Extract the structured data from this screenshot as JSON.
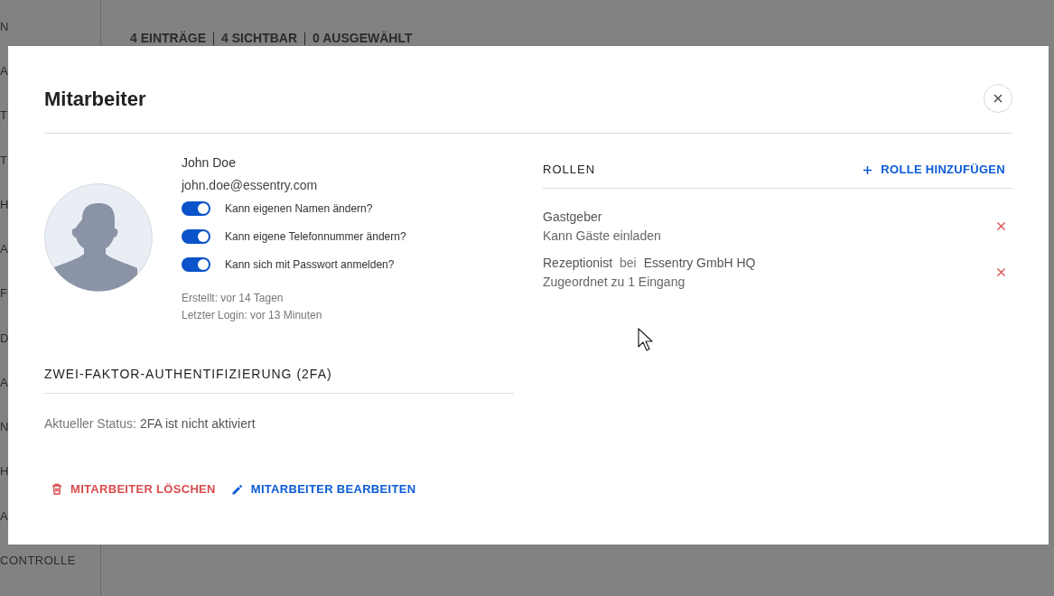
{
  "background": {
    "sidebar_items": [
      "N",
      "A",
      "T",
      "T",
      "H",
      "A",
      "F",
      "D",
      "A",
      "N",
      "H",
      "A",
      "CONTROLLE"
    ],
    "counts": [
      "4 EINTRÄGE",
      "4 SICHTBAR",
      "0 AUSGEWÄHLT"
    ]
  },
  "dialog": {
    "title": "Mitarbeiter",
    "user": {
      "name": "John Doe",
      "email": "john.doe@essentry.com"
    },
    "permissions": [
      {
        "label": "Kann eigenen Namen ändern?",
        "on": true
      },
      {
        "label": "Kann eigene Telefonnummer ändern?",
        "on": true
      },
      {
        "label": "Kann sich mit Passwort anmelden?",
        "on": true
      }
    ],
    "created": "Erstellt: vor 14 Tagen",
    "last_login": "Letzter Login: vor 13 Minuten",
    "twofa": {
      "heading": "ZWEI-FAKTOR-AUTHENTIFIZIERUNG (2FA)",
      "status_label": "Aktueller Status:",
      "status_value": "2FA ist nicht aktiviert"
    },
    "actions": [
      {
        "kind": "delete",
        "label": "MITARBEITER LÖSCHEN"
      },
      {
        "kind": "edit",
        "label": "MITARBEITER BEARBEITEN"
      }
    ],
    "roles": {
      "heading": "ROLLEN",
      "add_button": "ROLLE HINZUFÜGEN",
      "items": [
        {
          "name": "Gastgeber",
          "description": "Kann Gäste einladen"
        },
        {
          "name": "Rezeptionist",
          "connector": "bei",
          "location": "Essentry GmbH HQ",
          "description": "Zugeordnet zu 1 Eingang"
        }
      ]
    }
  }
}
